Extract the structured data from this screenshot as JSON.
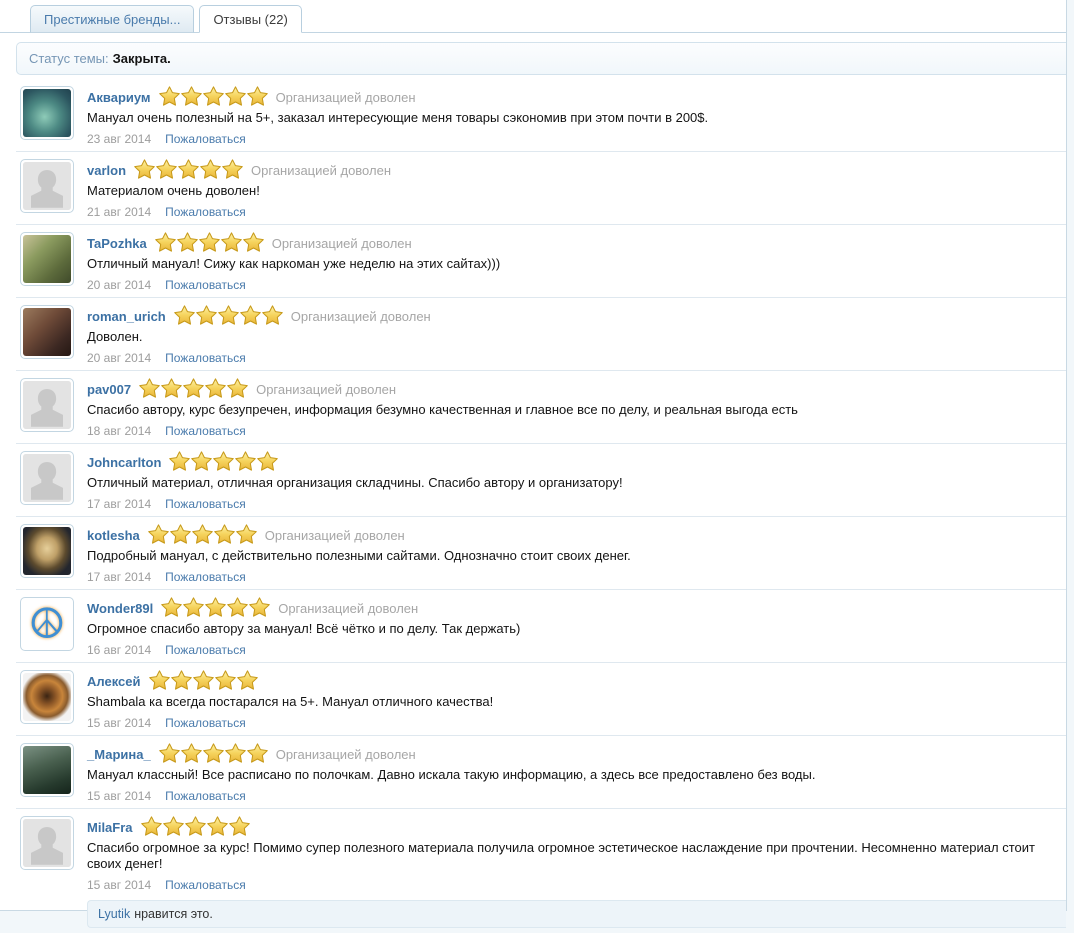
{
  "tabs": [
    {
      "label": "Престижные бренды...",
      "active": false
    },
    {
      "label": "Отзывы (22)",
      "active": true
    }
  ],
  "status": {
    "label": "Статус темы:",
    "value": "Закрыта."
  },
  "labels": {
    "report": "Пожаловаться",
    "org_satisfied": "Организацией доволен"
  },
  "icons": {
    "star": "star-icon",
    "peace": "peace-sign-icon",
    "default_avatar": "person-silhouette-icon"
  },
  "colors": {
    "link_blue": "#3c71a4",
    "report_blue": "#4a7bac",
    "star_gold": "#f6d45e",
    "star_outline": "#c79a1a",
    "muted_gray": "#9d9d9d",
    "status_label_blue": "#7696b5",
    "divider": "#dfe8ef",
    "tab_border": "#b8cfdf"
  },
  "reviews": [
    {
      "user": "Аквариум",
      "rating": 5,
      "org_satisfied": true,
      "avatar": "cheshire-cat",
      "text": "Мануал очень полезный на 5+, заказал интересующие меня товары сэкономив при этом почти в 200$.",
      "date": "23 авг 2014"
    },
    {
      "user": "varlon",
      "rating": 5,
      "org_satisfied": true,
      "avatar": "default",
      "text": "Материалом очень доволен!",
      "date": "21 авг 2014"
    },
    {
      "user": "TaPozhka",
      "rating": 5,
      "org_satisfied": true,
      "avatar": "garden-photo",
      "text": "Отличный мануал! Сижу как наркоман уже неделю на этих сайтах)))",
      "date": "20 авг 2014"
    },
    {
      "user": "roman_urich",
      "rating": 5,
      "org_satisfied": true,
      "avatar": "painting-photo",
      "text": "Доволен.",
      "date": "20 авг 2014"
    },
    {
      "user": "pav007",
      "rating": 5,
      "org_satisfied": true,
      "avatar": "default",
      "text": "Спасибо автору, курс безупречен, информация безумно качественная и главное все по делу, и реальная выгода есть",
      "date": "18 авг 2014"
    },
    {
      "user": "Johncarlton",
      "rating": 5,
      "org_satisfied": false,
      "avatar": "default",
      "text": "Отличный материал, отличная организация складчины. Спасибо автору и организатору!",
      "date": "17 авг 2014"
    },
    {
      "user": "kotlesha",
      "rating": 5,
      "org_satisfied": true,
      "avatar": "cat-emblem",
      "text": "Подробный мануал, с действительно полезными сайтами. Однозначно стоит своих денег.",
      "date": "17 авг 2014"
    },
    {
      "user": "Wonder89l",
      "rating": 5,
      "org_satisfied": true,
      "avatar": "peace-sign",
      "text": "Огромное спасибо автору за мануал! Всё чётко и по делу. Так держать)",
      "date": "16 авг 2014"
    },
    {
      "user": "Алексей",
      "rating": 5,
      "org_satisfied": false,
      "avatar": "lion",
      "text": "Shambala ка всегда постарался на 5+. Мануал отличного качества!",
      "date": "15 авг 2014"
    },
    {
      "user": "_Марина_",
      "rating": 5,
      "org_satisfied": true,
      "avatar": "swing-photo",
      "text": "Мануал классный! Все расписано по полочкам. Давно искала такую информацию, а здесь все предоставлено без воды.",
      "date": "15 авг 2014"
    },
    {
      "user": "MilaFra",
      "rating": 5,
      "org_satisfied": false,
      "avatar": "default",
      "text": "Спасибо огромное за курс! Помимо супер полезного материала получила огромное эстетическое наслаждение при прочтении. Несомненно материал стоит своих денег!",
      "date": "15 авг 2014",
      "has_likes": true
    }
  ],
  "likes": {
    "user": "Lyutik",
    "text": "нравится это."
  }
}
